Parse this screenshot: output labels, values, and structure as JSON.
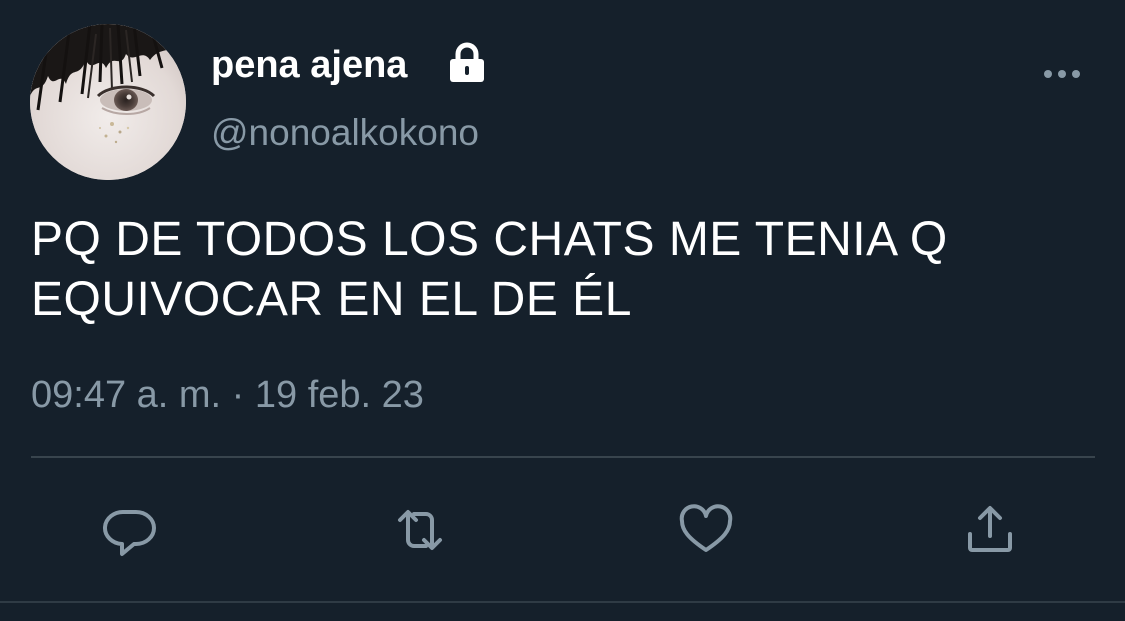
{
  "tweet": {
    "display_name": "pena ajena",
    "handle": "@nonoalkokono",
    "text_lines": [
      "PQ DE TODOS LOS CHATS ME TENIA Q",
      "EQUIVOCAR EN EL DE ÉL"
    ],
    "timestamp": "09:47 a. m. · 19 feb. 23",
    "protected": true
  },
  "icons": {
    "lock": "lock-icon",
    "more": "more-options-icon",
    "reply": "reply-icon",
    "retweet": "retweet-icon",
    "like": "heart-icon",
    "share": "share-icon"
  },
  "colors": {
    "background": "#15202b",
    "primary_text": "#ffffff",
    "secondary_text": "#8899a6",
    "divider": "#38444d"
  }
}
